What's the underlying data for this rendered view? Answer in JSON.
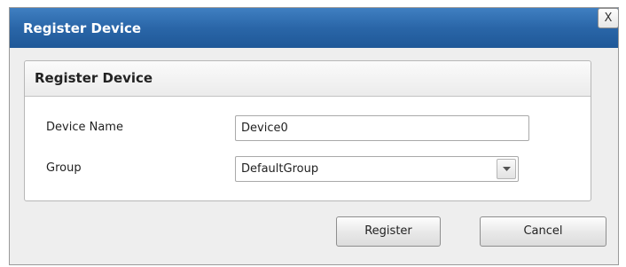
{
  "dialog": {
    "title": "Register Device",
    "close_label": "X"
  },
  "panel": {
    "title": "Register Device"
  },
  "form": {
    "device_name_label": "Device Name",
    "device_name_value": "Device0",
    "group_label": "Group",
    "group_selected": "DefaultGroup"
  },
  "buttons": {
    "register_label": "Register",
    "cancel_label": "Cancel"
  },
  "icons": {
    "dropdown": "chevron-down-icon"
  },
  "colors": {
    "titlebar": "#2a66a8",
    "title_text": "#ffffff",
    "dialog_background": "#eeeeee"
  }
}
